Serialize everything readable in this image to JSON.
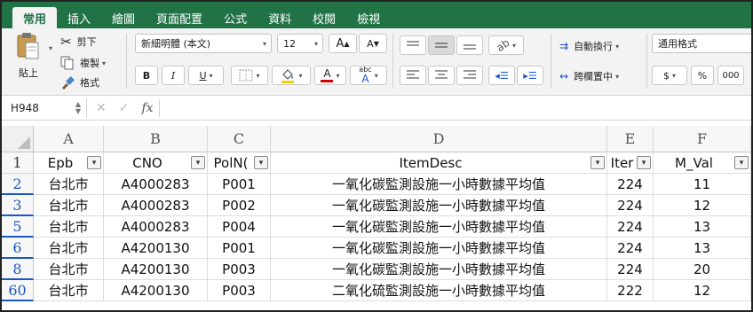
{
  "ribbon_tabs": [
    "常用",
    "插入",
    "繪圖",
    "頁面配置",
    "公式",
    "資料",
    "校閱",
    "檢視"
  ],
  "clipboard": {
    "paste": "貼上",
    "cut": "剪下",
    "copy": "複製",
    "format_painter": "格式"
  },
  "font": {
    "name": "新細明體 (本文)",
    "size": "12",
    "grow": "A",
    "shrink": "A",
    "bold": "B",
    "italic": "I",
    "underline": "U",
    "font_color_letter": "A",
    "abc_label": "abc"
  },
  "alignment": {
    "wrap_text": "自動換行",
    "merge_center": "跨欄置中"
  },
  "number": {
    "format": "通用格式",
    "currency": "$",
    "percent": "%",
    "thousands": "000"
  },
  "formula_bar": {
    "cell_ref": "H948",
    "fx": "fx",
    "value": ""
  },
  "columns": [
    "A",
    "B",
    "C",
    "D",
    "E",
    "F"
  ],
  "header_row": {
    "row_num": "1",
    "cells": [
      "Epb",
      "CNO",
      "PolN(",
      "ItemDesc",
      "Iter",
      "M_Val"
    ]
  },
  "rows": [
    {
      "row_num": "2",
      "cells": [
        "台北市",
        "A4000283",
        "P001",
        "一氧化碳監測設施一小時數據平均值",
        "224",
        "11"
      ]
    },
    {
      "row_num": "3",
      "cells": [
        "台北市",
        "A4000283",
        "P002",
        "一氧化碳監測設施一小時數據平均值",
        "224",
        "12"
      ]
    },
    {
      "row_num": "5",
      "cells": [
        "台北市",
        "A4000283",
        "P004",
        "一氧化碳監測設施一小時數據平均值",
        "224",
        "13"
      ]
    },
    {
      "row_num": "6",
      "cells": [
        "台北市",
        "A4200130",
        "P001",
        "一氧化碳監測設施一小時數據平均值",
        "224",
        "13"
      ]
    },
    {
      "row_num": "8",
      "cells": [
        "台北市",
        "A4200130",
        "P003",
        "一氧化碳監測設施一小時數據平均值",
        "224",
        "20"
      ]
    },
    {
      "row_num": "60",
      "cells": [
        "台北市",
        "A4200130",
        "P003",
        "二氧化硫監測設施一小時數據平均值",
        "222",
        "12"
      ]
    }
  ],
  "colors": {
    "ribbon_green": "#217346",
    "row_number_blue": "#1a56c4"
  }
}
